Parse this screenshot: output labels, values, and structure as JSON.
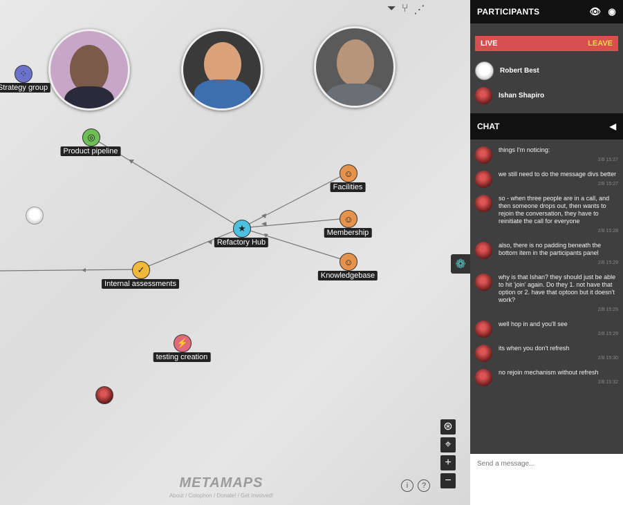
{
  "map": {
    "topics": [
      {
        "label": "Strategy group",
        "color": "#6a73c8",
        "glyph": "⁘"
      },
      {
        "label": "Product pipeline",
        "color": "#6fbd56",
        "glyph": "◎"
      },
      {
        "label": "Facilities",
        "color": "#e7924a",
        "glyph": "☺"
      },
      {
        "label": "Membership",
        "color": "#e7924a",
        "glyph": "☺"
      },
      {
        "label": "Knowledgebase",
        "color": "#e7924a",
        "glyph": "☺"
      },
      {
        "label": "Refactory Hub",
        "color": "#4fbfe0",
        "glyph": "★"
      },
      {
        "label": "Internal assessments",
        "color": "#f0b93a",
        "glyph": "✓"
      },
      {
        "label": "testing creation",
        "color": "#e06a7a",
        "glyph": "⚡"
      }
    ],
    "brand": {
      "logo": "METAMAPS",
      "links": "About / Colophon / Donate! / Get Involved!"
    },
    "info_btn": "i",
    "help_btn": "?",
    "zoom_in": "+",
    "zoom_out": "−"
  },
  "panel": {
    "participants_title": "PARTICIPANTS",
    "live_label": "LIVE",
    "leave_label": "LEAVE",
    "participants": [
      {
        "name": "Robert Best",
        "avatar": "white"
      },
      {
        "name": "Ishan Shapiro",
        "avatar": "red"
      }
    ],
    "chat_title": "CHAT",
    "messages": [
      {
        "text": "things I'm noticing:",
        "time": "2/8 15:27"
      },
      {
        "text": "we still need to do the message divs better",
        "time": "2/8 15:27"
      },
      {
        "text": "so - when three people are in a call, and then someone drops out, then wants to rejoin the conversation, they have to reinitiate the call for everyone",
        "time": "2/8 15:28"
      },
      {
        "text": "also, there is no padding beneath the bottom item in the participants panel",
        "time": "2/8 15:29"
      },
      {
        "text": "why is that Ishan? they should just be able to hit 'join' again. Do they 1. not have that option or 2. have that optoon but it doesn't work?",
        "time": "2/8 15:29"
      },
      {
        "text": "well hop in and you'll see",
        "time": "2/8 15:29"
      },
      {
        "text": "its when you don't refresh",
        "time": "2/8 15:30"
      },
      {
        "text": "no rejoin mechanism without refresh",
        "time": "2/8 15:32"
      }
    ],
    "composer_placeholder": "Send a message..."
  }
}
